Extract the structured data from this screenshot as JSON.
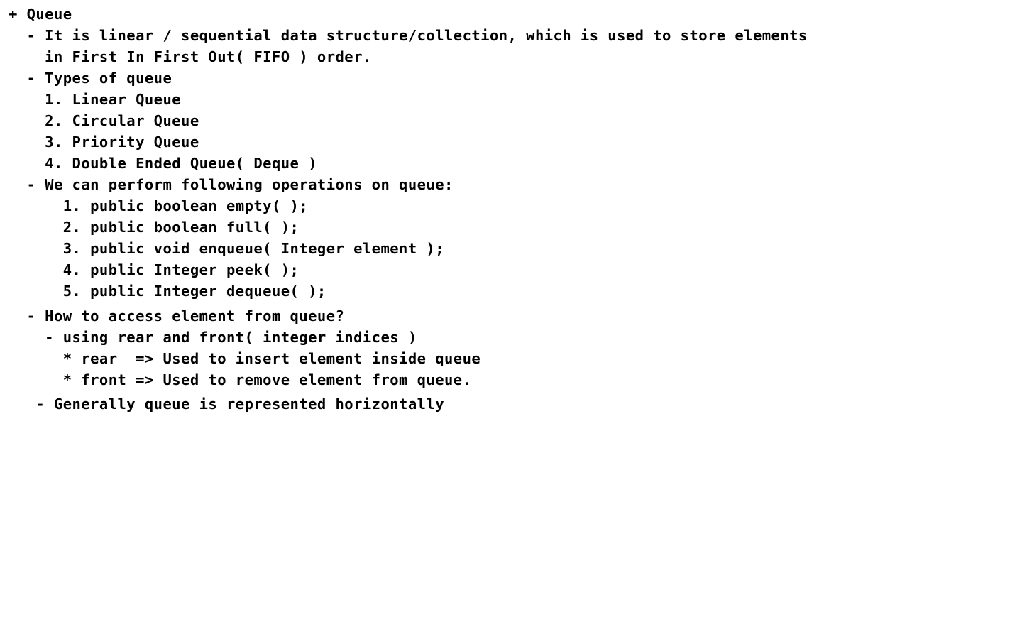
{
  "document": {
    "lines": [
      "+ Queue",
      "  - It is linear / sequential data structure/collection, which is used to store elements",
      "    in First In First Out( FIFO ) order.",
      "  - Types of queue",
      "    1. Linear Queue",
      "    2. Circular Queue",
      "    3. Priority Queue",
      "    4. Double Ended Queue( Deque )",
      "  - We can perform following operations on queue:",
      "      1. public boolean empty( );",
      "      2. public boolean full( );",
      "      3. public void enqueue( Integer element );",
      "      4. public Integer peek( );",
      "      5. public Integer dequeue( );",
      "  - How to access element from queue?",
      "    - using rear and front( integer indices )",
      "      * rear  => Used to insert element inside queue",
      "      * front => Used to remove element from queue.",
      "   - Generally queue is represented horizontally"
    ]
  }
}
